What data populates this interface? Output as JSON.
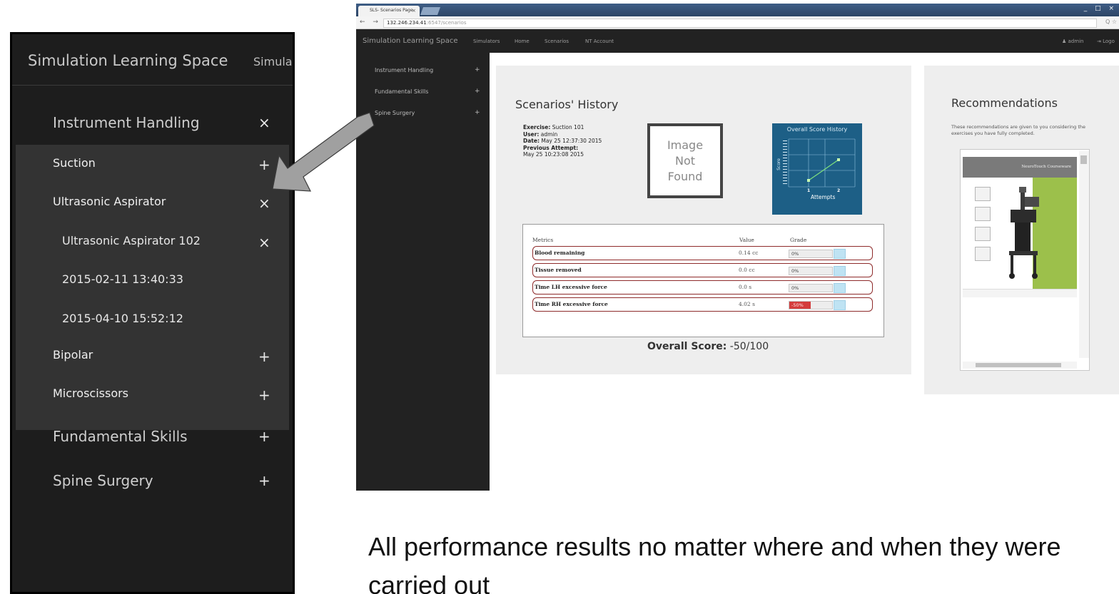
{
  "zoom_panel": {
    "brand": "Simulation Learning Space",
    "simula": "Simula",
    "items": [
      {
        "label": "Instrument Handling",
        "symbol": "×"
      },
      {
        "label": "Suction",
        "symbol": "+"
      },
      {
        "label": "Ultrasonic Aspirator",
        "symbol": "×"
      },
      {
        "label": "Ultrasonic Aspirator 102",
        "symbol": "×"
      },
      {
        "label": "2015-02-11 13:40:33",
        "symbol": ""
      },
      {
        "label": "2015-04-10 15:52:12",
        "symbol": ""
      },
      {
        "label": "Bipolar",
        "symbol": "+"
      },
      {
        "label": "Microscissors",
        "symbol": "+"
      },
      {
        "label": "Fundamental Skills",
        "symbol": "+"
      },
      {
        "label": "Spine Surgery",
        "symbol": "+"
      }
    ]
  },
  "browser": {
    "tab_title": "SLS- Scenarios Page",
    "tab_close": "×",
    "url_host": "132.246.234.41",
    "url_path": ":6547/scenarios",
    "nav_icons": "← → C",
    "addr_right": "Q ☆",
    "win_ctrls": "_ □ ×"
  },
  "navbar": {
    "brand": "Simulation Learning Space",
    "links": [
      "Simulators",
      "Home",
      "Scenarios",
      "NT Account"
    ],
    "admin": "admin",
    "logout": "Logo"
  },
  "sidebar": {
    "items": [
      {
        "label": "Instrument Handling",
        "symbol": "+"
      },
      {
        "label": "Fundamental Skills",
        "symbol": "+"
      },
      {
        "label": "Spine Surgery",
        "symbol": "+"
      }
    ]
  },
  "history": {
    "title": "Scenarios' History",
    "exercise_label": "Exercise:",
    "exercise_value": "Suction 101",
    "user_label": "User:",
    "user_value": "admin",
    "date_label": "Date:",
    "date_value": "May 25 12:37:30 2015",
    "prev_label": "Previous Attempt:",
    "prev_value": "May 25 10:23:08 2015",
    "image_placeholder": [
      "Image",
      "Not",
      "Found"
    ],
    "overall_label": "Overall Score:",
    "overall_value": "-50/100"
  },
  "score_chart": {
    "title": "Overall Score History",
    "ylabel": "Score",
    "xlabel": "Attempts",
    "x_ticks": [
      "1",
      "2"
    ]
  },
  "metrics": {
    "headers": [
      "Metrics",
      "Value",
      "Grade"
    ],
    "rows": [
      {
        "name": "Blood remaining",
        "value": "0.14 cc",
        "grade": "0%",
        "grade_pct": 0
      },
      {
        "name": "Tissue removed",
        "value": "0.0 cc",
        "grade": "0%",
        "grade_pct": 0
      },
      {
        "name": "Time LH excessive force",
        "value": "0.0 s",
        "grade": "0%",
        "grade_pct": 0
      },
      {
        "name": "Time RH excessive force",
        "value": "4.02 s",
        "grade": "-50%",
        "grade_pct": -50
      }
    ]
  },
  "recommendations": {
    "title": "Recommendations",
    "text": "These recommendations are given to you considering the exercises you have fully completed.",
    "pdf_header": "NeuroTouch Courseware"
  },
  "caption": "All performance results no matter where and when they were carried out",
  "colors": {
    "navbar_bg": "#222222",
    "score_card": "#1d5f86",
    "metric_border": "#8e2b2b",
    "negative_grade": "#d43c3c",
    "arrow_fill": "#a0a0a0"
  }
}
